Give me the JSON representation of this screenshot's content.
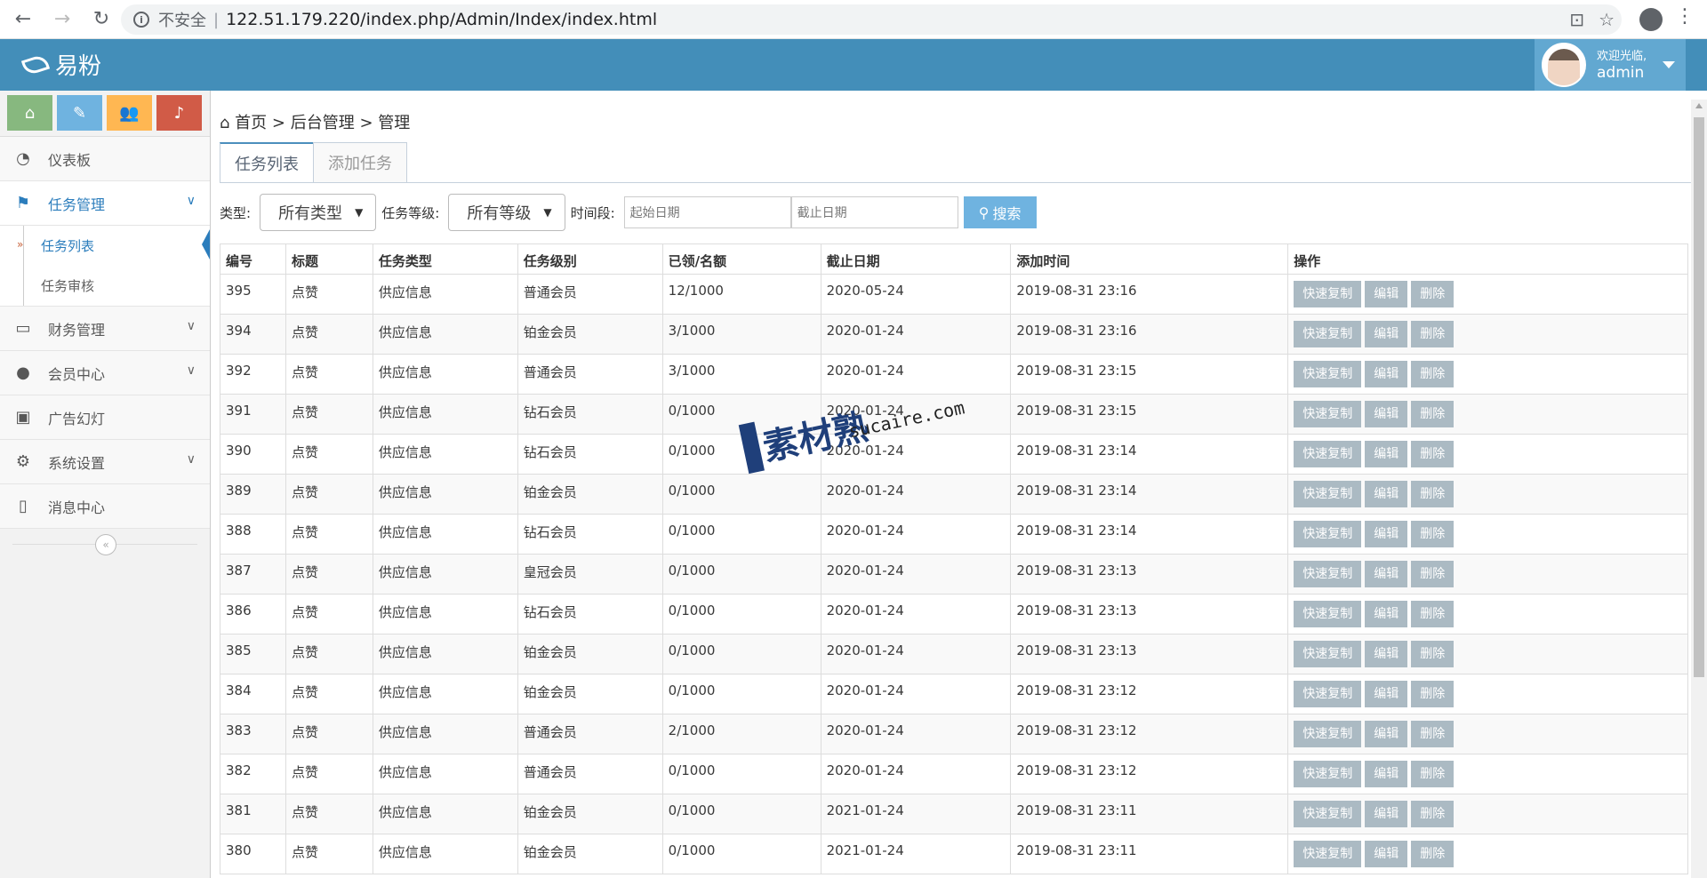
{
  "browser": {
    "security_label": "不安全",
    "url": "122.51.179.220/index.php/Admin/Index/index.html"
  },
  "app": {
    "name": "易粉",
    "user": {
      "welcome": "欢迎光临,",
      "name": "admin"
    }
  },
  "sidebar": {
    "shortcuts": [
      {
        "icon": "home-icon",
        "color": "#87b87f"
      },
      {
        "icon": "pencil-icon",
        "color": "#6fb3e0"
      },
      {
        "icon": "users-icon",
        "color": "#ffb752"
      },
      {
        "icon": "bell-icon",
        "color": "#d15b47"
      }
    ],
    "items": [
      {
        "label": "仪表板",
        "icon": "dashboard-icon"
      },
      {
        "label": "任务管理",
        "icon": "flag-icon",
        "open": true,
        "children": [
          "任务列表",
          "任务审核"
        ]
      },
      {
        "label": "财务管理",
        "icon": "drive-icon"
      },
      {
        "label": "会员中心",
        "icon": "user-icon"
      },
      {
        "label": "广告幻灯",
        "icon": "picture-icon"
      },
      {
        "label": "系统设置",
        "icon": "gear-icon"
      },
      {
        "label": "消息中心",
        "icon": "bookmark-icon"
      }
    ]
  },
  "main": {
    "breadcrumb": {
      "home": "首页",
      "level2": "后台管理",
      "level3": "管理"
    },
    "tabs": [
      "任务列表",
      "添加任务"
    ],
    "filters": {
      "type_label": "类型:",
      "type_value": "所有类型",
      "level_label": "任务等级:",
      "level_value": "所有等级",
      "period_label": "时间段:",
      "start_placeholder": "起始日期",
      "end_placeholder": "截止日期",
      "search_label": "搜索"
    },
    "table": {
      "headers": [
        "编号",
        "标题",
        "任务类型",
        "任务级别",
        "已领/名额",
        "截止日期",
        "添加时间",
        "操作"
      ],
      "actions": [
        "快速复制",
        "编辑",
        "删除"
      ],
      "rows": [
        [
          "395",
          "点赞",
          "供应信息",
          "普通会员",
          "12/1000",
          "2020-05-24",
          "2019-08-31 23:16"
        ],
        [
          "394",
          "点赞",
          "供应信息",
          "铂金会员",
          "3/1000",
          "2020-01-24",
          "2019-08-31 23:16"
        ],
        [
          "392",
          "点赞",
          "供应信息",
          "普通会员",
          "3/1000",
          "2020-01-24",
          "2019-08-31 23:15"
        ],
        [
          "391",
          "点赞",
          "供应信息",
          "钻石会员",
          "0/1000",
          "2020-01-24",
          "2019-08-31 23:15"
        ],
        [
          "390",
          "点赞",
          "供应信息",
          "钻石会员",
          "0/1000",
          "2020-01-24",
          "2019-08-31 23:14"
        ],
        [
          "389",
          "点赞",
          "供应信息",
          "铂金会员",
          "0/1000",
          "2020-01-24",
          "2019-08-31 23:14"
        ],
        [
          "388",
          "点赞",
          "供应信息",
          "钻石会员",
          "0/1000",
          "2020-01-24",
          "2019-08-31 23:14"
        ],
        [
          "387",
          "点赞",
          "供应信息",
          "皇冠会员",
          "0/1000",
          "2020-01-24",
          "2019-08-31 23:13"
        ],
        [
          "386",
          "点赞",
          "供应信息",
          "钻石会员",
          "0/1000",
          "2020-01-24",
          "2019-08-31 23:13"
        ],
        [
          "385",
          "点赞",
          "供应信息",
          "铂金会员",
          "0/1000",
          "2020-01-24",
          "2019-08-31 23:13"
        ],
        [
          "384",
          "点赞",
          "供应信息",
          "铂金会员",
          "0/1000",
          "2020-01-24",
          "2019-08-31 23:12"
        ],
        [
          "383",
          "点赞",
          "供应信息",
          "普通会员",
          "2/1000",
          "2020-01-24",
          "2019-08-31 23:12"
        ],
        [
          "382",
          "点赞",
          "供应信息",
          "普通会员",
          "0/1000",
          "2020-01-24",
          "2019-08-31 23:12"
        ],
        [
          "381",
          "点赞",
          "供应信息",
          "铂金会员",
          "0/1000",
          "2021-01-24",
          "2019-08-31 23:11"
        ],
        [
          "380",
          "点赞",
          "供应信息",
          "铂金会员",
          "0/1000",
          "2021-01-24",
          "2019-08-31 23:11"
        ]
      ]
    }
  },
  "watermark": {
    "text": "素材熟",
    "sub": "sucaire.com"
  }
}
